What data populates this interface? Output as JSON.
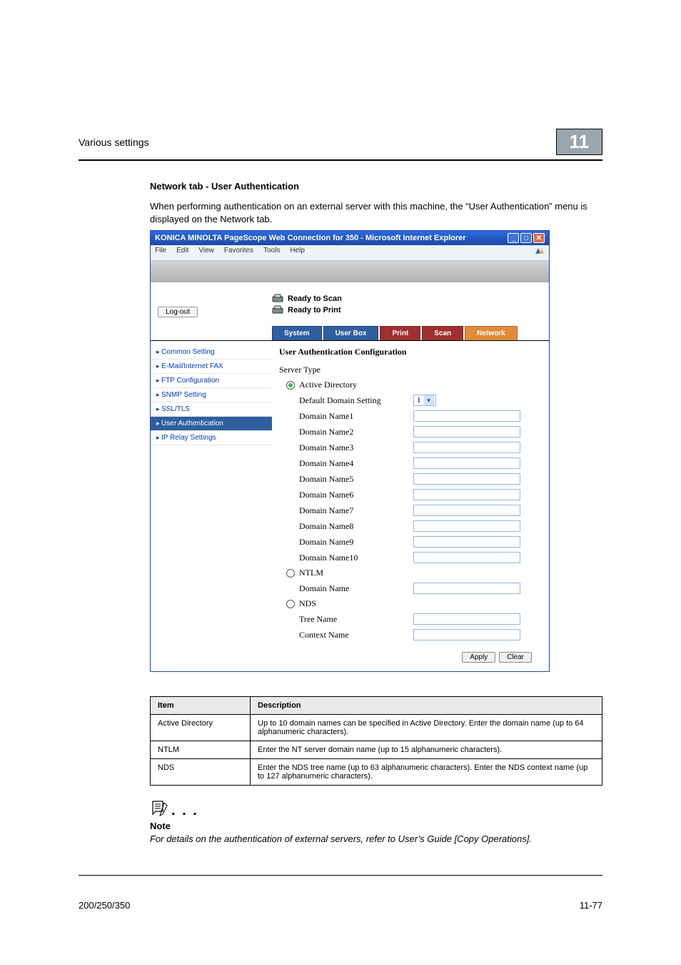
{
  "header": {
    "section": "Various settings",
    "chapter": "11"
  },
  "content": {
    "heading": "Network tab - User Authentication",
    "para": "When performing authentication on an external server with this machine, the “User Authentication” menu is displayed on the Network tab."
  },
  "browser": {
    "title": "KONICA MINOLTA PageScope Web Connection for 350 - Microsoft Internet Explorer",
    "menu": {
      "file": "File",
      "edit": "Edit",
      "view": "View",
      "favorites": "Favorites",
      "tools": "Tools",
      "help": "Help"
    }
  },
  "status": {
    "scan": "Ready to Scan",
    "print": "Ready to Print",
    "logout": "Log-out"
  },
  "tabs": {
    "system": "System",
    "userbox": "User Box",
    "print": "Print",
    "scan": "Scan",
    "network": "Network"
  },
  "sidebar": {
    "items": [
      "Common Setting",
      "E-Mail/Internet FAX",
      "FTP Configuration",
      "SNMP Setting",
      "SSL/TLS",
      "User Authentication",
      "IP Relay Settings"
    ]
  },
  "form": {
    "title": "User Authentication Configuration",
    "server_type": "Server Type",
    "ad": "Active Directory",
    "default_domain": "Default Domain Setting",
    "default_domain_value": "1",
    "dn": {
      "1": "Domain Name1",
      "2": "Domain Name2",
      "3": "Domain Name3",
      "4": "Domain Name4",
      "5": "Domain Name5",
      "6": "Domain Name6",
      "7": "Domain Name7",
      "8": "Domain Name8",
      "9": "Domain Name9",
      "10": "Domain Name10"
    },
    "ntlm": "NTLM",
    "ntlm_domain": "Domain Name",
    "nds": "NDS",
    "nds_tree": "Tree Name",
    "nds_context": "Context Name",
    "apply": "Apply",
    "clear": "Clear"
  },
  "table": {
    "h1": "Item",
    "h2": "Description",
    "r1c1": "Active Directory",
    "r1c2": "Up to 10 domain names can be specified in Active Directory. Enter the domain name (up to 64 alphanumeric characters).",
    "r2c1": "NTLM",
    "r2c2": "Enter the NT server domain name (up to 15 alphanumeric characters).",
    "r3c1": "NDS",
    "r3c2": "Enter the NDS tree name (up to 63 alphanumeric characters). Enter the NDS context name (up to 127 alphanumeric characters)."
  },
  "note": {
    "heading": "Note",
    "text": "For details on the authentication of external servers, refer to User’s Guide [Copy Operations]."
  },
  "footer": {
    "left": "200/250/350",
    "right": "11-77"
  }
}
